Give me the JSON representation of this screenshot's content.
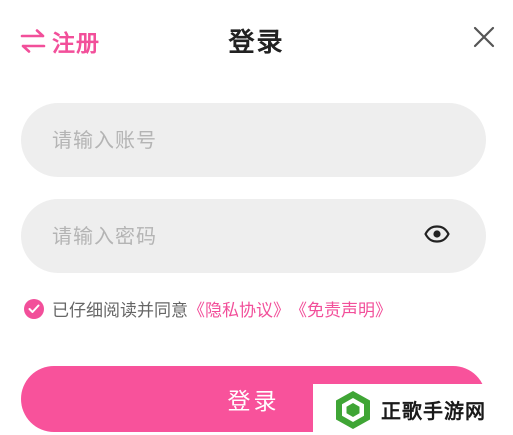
{
  "header": {
    "switch_label": "注册",
    "title": "登录",
    "switch_icon": "swap-icon",
    "close_icon": "close-icon"
  },
  "form": {
    "account": {
      "value": "",
      "placeholder": "请输入账号"
    },
    "password": {
      "value": "",
      "placeholder": "请输入密码",
      "toggle_icon": "eye-icon"
    },
    "agreement": {
      "checked": true,
      "text": "已仔细阅读并同意",
      "privacy_link": "《隐私协议》",
      "disclaimer_link": "《免责声明》"
    },
    "submit_label": "登录"
  },
  "watermark": {
    "text": "正歌手游网"
  },
  "colors": {
    "accent": "#f24f9a",
    "button": "#f8529b",
    "field_bg": "#eeeeee",
    "placeholder": "#b4b4b4",
    "watermark_green": "#3fa535"
  }
}
